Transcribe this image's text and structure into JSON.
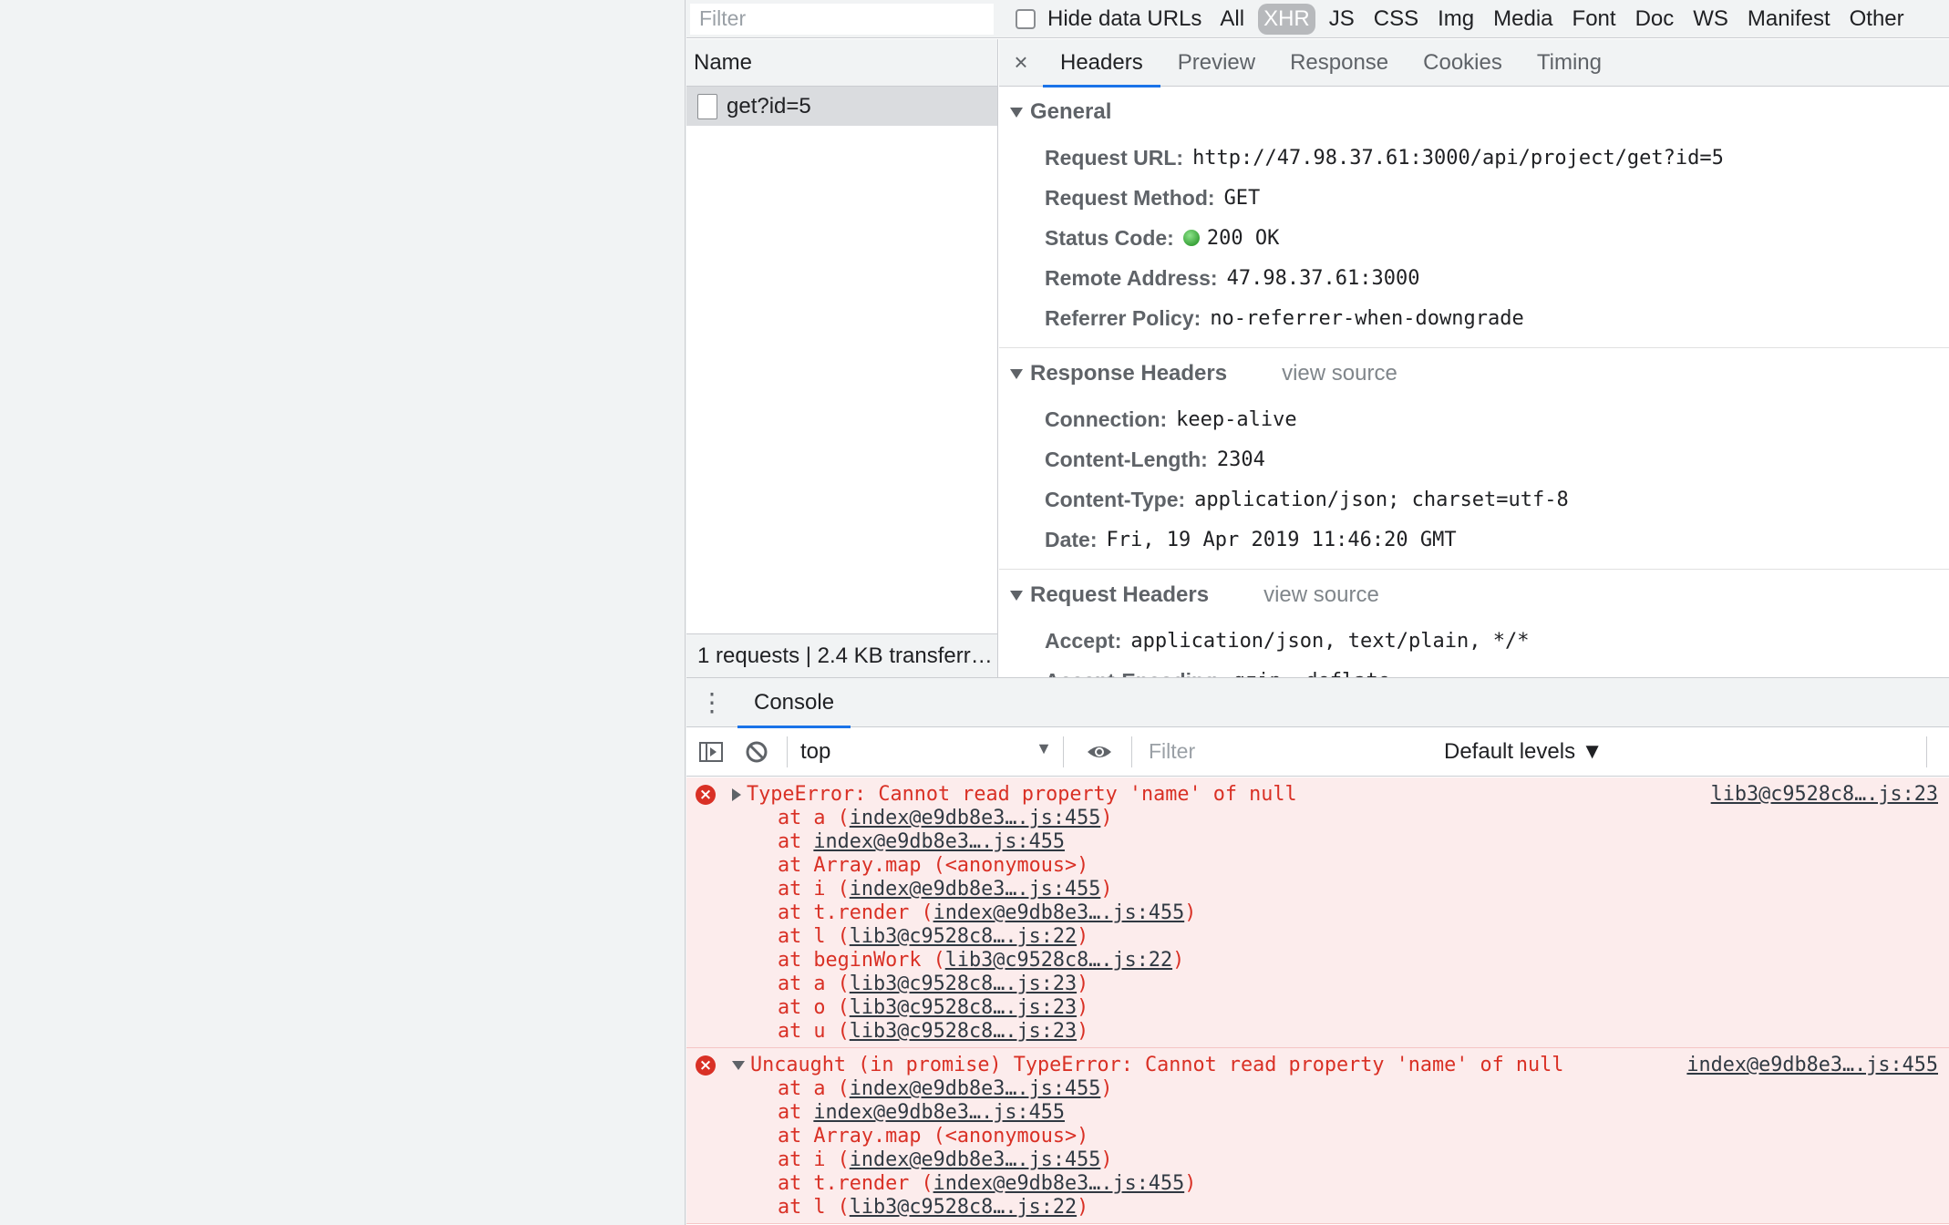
{
  "network": {
    "filter_placeholder": "Filter",
    "hide_data_urls": "Hide data URLs",
    "types": [
      "All",
      "XHR",
      "JS",
      "CSS",
      "Img",
      "Media",
      "Font",
      "Doc",
      "WS",
      "Manifest",
      "Other"
    ],
    "active_type": "XHR",
    "list_header": "Name",
    "request_name": "get?id=5",
    "status_bar": "1 requests | 2.4 KB transferr…"
  },
  "detail": {
    "close": "×",
    "tabs": [
      "Headers",
      "Preview",
      "Response",
      "Cookies",
      "Timing"
    ],
    "active_tab": "Headers",
    "general": {
      "title": "General",
      "rows": [
        {
          "k": "Request URL:",
          "v": "http://47.98.37.61:3000/api/project/get?id=5"
        },
        {
          "k": "Request Method:",
          "v": "GET"
        },
        {
          "k": "Status Code:",
          "v": "200 OK"
        },
        {
          "k": "Remote Address:",
          "v": "47.98.37.61:3000"
        },
        {
          "k": "Referrer Policy:",
          "v": "no-referrer-when-downgrade"
        }
      ]
    },
    "response_headers": {
      "title": "Response Headers",
      "view_source": "view source",
      "rows": [
        {
          "k": "Connection:",
          "v": "keep-alive"
        },
        {
          "k": "Content-Length:",
          "v": "2304"
        },
        {
          "k": "Content-Type:",
          "v": "application/json; charset=utf-8"
        },
        {
          "k": "Date:",
          "v": "Fri, 19 Apr 2019 11:46:20 GMT"
        }
      ]
    },
    "request_headers": {
      "title": "Request Headers",
      "view_source": "view source",
      "rows": [
        {
          "k": "Accept:",
          "v": "application/json, text/plain, */*"
        },
        {
          "k": "Accept-Encoding:",
          "v": "gzip, deflate"
        }
      ]
    }
  },
  "console": {
    "tab": "Console",
    "context": "top",
    "filter_placeholder": "Filter",
    "levels": "Default levels ▼",
    "messages": [
      {
        "text": "TypeError: Cannot read property 'name' of null",
        "source": "lib3@c9528c8….js:23",
        "stack": [
          [
            "at a (",
            "index@e9db8e3….js:455",
            ")"
          ],
          [
            "at ",
            "index@e9db8e3….js:455",
            ""
          ],
          [
            "at Array.map (<anonymous>)",
            "",
            ""
          ],
          [
            "at i (",
            "index@e9db8e3….js:455",
            ")"
          ],
          [
            "at t.render (",
            "index@e9db8e3….js:455",
            ")"
          ],
          [
            "at l (",
            "lib3@c9528c8….js:22",
            ")"
          ],
          [
            "at beginWork (",
            "lib3@c9528c8….js:22",
            ")"
          ],
          [
            "at a (",
            "lib3@c9528c8….js:23",
            ")"
          ],
          [
            "at o (",
            "lib3@c9528c8….js:23",
            ")"
          ],
          [
            "at u (",
            "lib3@c9528c8….js:23",
            ")"
          ]
        ]
      },
      {
        "text": "Uncaught (in promise) TypeError: Cannot read property 'name' of null",
        "source": "index@e9db8e3….js:455",
        "stack": [
          [
            "at a (",
            "index@e9db8e3….js:455",
            ")"
          ],
          [
            "at ",
            "index@e9db8e3….js:455",
            ""
          ],
          [
            "at Array.map (<anonymous>)",
            "",
            ""
          ],
          [
            "at i (",
            "index@e9db8e3….js:455",
            ")"
          ],
          [
            "at t.render (",
            "index@e9db8e3….js:455",
            ")"
          ],
          [
            "at l (",
            "lib3@c9528c8….js:22",
            ")"
          ]
        ]
      }
    ]
  }
}
